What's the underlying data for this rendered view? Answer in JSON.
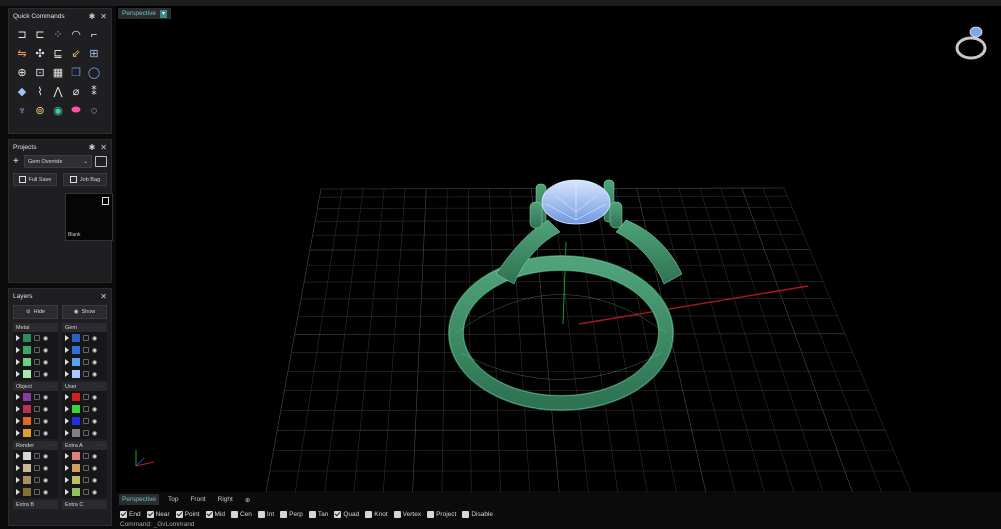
{
  "quick_commands": {
    "title": "Quick Commands",
    "icons": [
      {
        "name": "undo-curve-icon",
        "color": "#e8e8e8"
      },
      {
        "name": "corner-icon",
        "color": "#e8e8e8"
      },
      {
        "name": "points-icon",
        "color": "#9fb6e6"
      },
      {
        "name": "arc-icon",
        "color": "#e8e8e8"
      },
      {
        "name": "fillet-icon",
        "color": "#e8e8e8"
      },
      {
        "name": "mirror-icon",
        "color": "#f0a060"
      },
      {
        "name": "move-icon",
        "color": "#e8e8e8"
      },
      {
        "name": "rotate-corner-icon",
        "color": "#e8e8e8"
      },
      {
        "name": "scale-icon",
        "color": "#f0c070"
      },
      {
        "name": "array-icon",
        "color": "#a0c0f0"
      },
      {
        "name": "split-icon",
        "color": "#e8e8e8"
      },
      {
        "name": "trim-icon",
        "color": "#e8e8e8"
      },
      {
        "name": "grid-array-icon",
        "color": "#e8e8e8"
      },
      {
        "name": "copy-icon",
        "color": "#6090e0"
      },
      {
        "name": "ring-icon",
        "color": "#7aa6ff"
      },
      {
        "name": "gem-icon",
        "color": "#a0c0ff"
      },
      {
        "name": "prong-icon",
        "color": "#e8e8e8"
      },
      {
        "name": "pave-icon",
        "color": "#e8e8e8"
      },
      {
        "name": "cutter-icon",
        "color": "#e8e8e8"
      },
      {
        "name": "sparkle-icon",
        "color": "#e8e8e8"
      },
      {
        "name": "head-icon",
        "color": "#c0a0ff"
      },
      {
        "name": "orbit-icon",
        "color": "#f0d080"
      },
      {
        "name": "sphere-icon",
        "color": "#40d0a0"
      },
      {
        "name": "torus-icon",
        "color": "#ff4fa0"
      },
      {
        "name": "ring-band-icon",
        "color": "#ffffff"
      }
    ]
  },
  "projects": {
    "title": "Projects",
    "current": "Gem Override",
    "full_save": "Full Save",
    "job_bag": "Job Bag",
    "thumb_label": "Blank"
  },
  "layers": {
    "title": "Layers",
    "hide": "Hide",
    "show": "Show",
    "groups": [
      {
        "name": "Metal",
        "colors": [
          "#2f8a5a",
          "#3aa565",
          "#6bd080",
          "#a8e8a8"
        ]
      },
      {
        "name": "Gem",
        "colors": [
          "#2a60c0",
          "#3070d8",
          "#5aa0f0",
          "#a8c8ff"
        ]
      },
      {
        "name": "Object",
        "colors": [
          "#8a3aa0",
          "#c03050",
          "#e06820",
          "#e0a030"
        ]
      },
      {
        "name": "User",
        "colors": [
          "#d02020",
          "#40d040",
          "#2030e0",
          "#808080"
        ]
      },
      {
        "name": "Render",
        "colors": [
          "#d8d8d8",
          "#c8b898",
          "#a89060",
          "#8a7030"
        ]
      },
      {
        "name": "Extra A",
        "colors": [
          "#e08080",
          "#d0a060",
          "#c0c060",
          "#90c060"
        ]
      }
    ],
    "extra_groups": [
      "Extra B",
      "Extra C"
    ]
  },
  "viewport": {
    "active_view": "Perspective",
    "ring_metal_color": "#3f8f69",
    "gem_color": "#a9c9f5"
  },
  "view_tabs": [
    "Perspective",
    "Top",
    "Front",
    "Right"
  ],
  "snaps": [
    {
      "label": "End",
      "on": true
    },
    {
      "label": "Near",
      "on": true
    },
    {
      "label": "Point",
      "on": true
    },
    {
      "label": "Mid",
      "on": true
    },
    {
      "label": "Cen",
      "on": false
    },
    {
      "label": "Int",
      "on": false
    },
    {
      "label": "Perp",
      "on": false
    },
    {
      "label": "Tan",
      "on": false
    },
    {
      "label": "Quad",
      "on": true
    },
    {
      "label": "Knot",
      "on": false
    },
    {
      "label": "Vertex",
      "on": false
    },
    {
      "label": "Project",
      "on": false
    },
    {
      "label": "Disable",
      "on": false
    }
  ],
  "command_line": "Command: _GvLommand"
}
